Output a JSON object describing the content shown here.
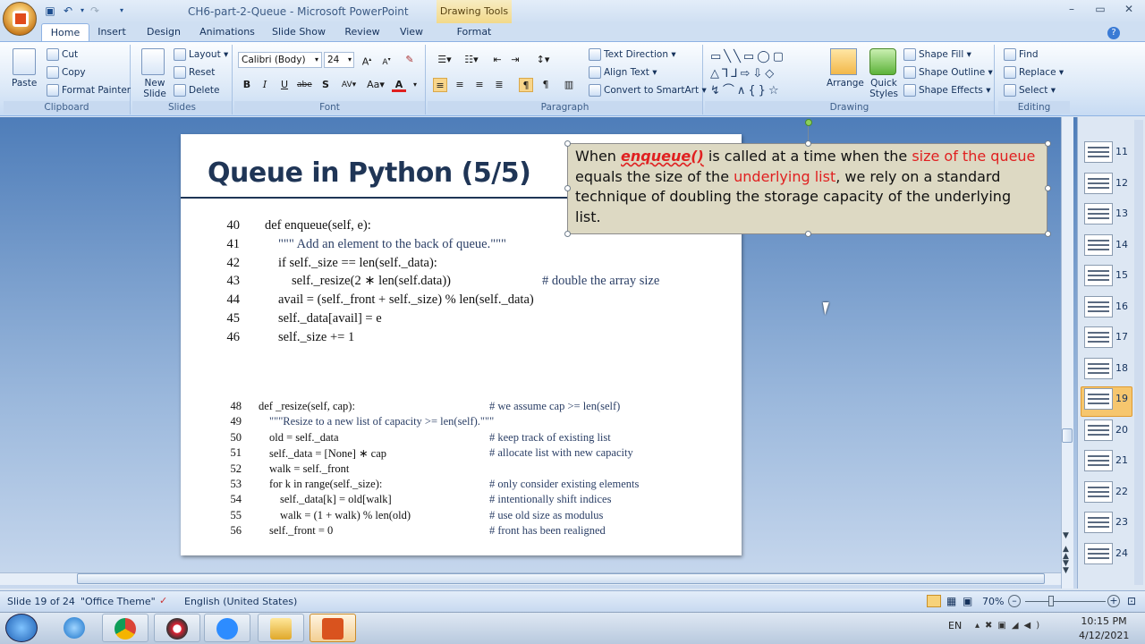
{
  "window": {
    "title": "CH6-part-2-Queue - Microsoft PowerPoint",
    "contextual_tab": "Drawing Tools"
  },
  "tabs": [
    "Home",
    "Insert",
    "Design",
    "Animations",
    "Slide Show",
    "Review",
    "View",
    "Format"
  ],
  "ribbon": {
    "clipboard": {
      "label": "Clipboard",
      "paste": "Paste",
      "cut": "Cut",
      "copy": "Copy",
      "format_painter": "Format Painter"
    },
    "slides": {
      "label": "Slides",
      "new_slide": "New Slide",
      "layout": "Layout",
      "reset": "Reset",
      "delete": "Delete"
    },
    "font": {
      "label": "Font",
      "family": "Calibri (Body)",
      "size": "24"
    },
    "paragraph": {
      "label": "Paragraph",
      "text_direction": "Text Direction",
      "align_text": "Align Text",
      "convert_smartart": "Convert to SmartArt"
    },
    "drawing": {
      "label": "Drawing",
      "arrange": "Arrange",
      "quick_styles": "Quick Styles",
      "shape_fill": "Shape Fill",
      "shape_outline": "Shape Outline",
      "shape_effects": "Shape Effects"
    },
    "editing": {
      "label": "Editing",
      "find": "Find",
      "replace": "Replace",
      "select": "Select"
    }
  },
  "slide": {
    "title": "Queue in Python (5/5)",
    "code_block_1": [
      {
        "n": "40",
        "text": "def enqueue(self, e):",
        "indent": 0,
        "comment": ""
      },
      {
        "n": "41",
        "text": "\"\"\" Add an element to the back of queue.\"\"\"",
        "indent": 1,
        "comment": ""
      },
      {
        "n": "42",
        "text": "if self._size == len(self._data):",
        "indent": 1,
        "comment": ""
      },
      {
        "n": "43",
        "text": "self._resize(2 ∗ len(self.data))",
        "indent": 2,
        "comment": "# double the array size"
      },
      {
        "n": "44",
        "text": "avail = (self._front + self._size) % len(self._data)",
        "indent": 1,
        "comment": ""
      },
      {
        "n": "45",
        "text": "self._data[avail] = e",
        "indent": 1,
        "comment": ""
      },
      {
        "n": "46",
        "text": "self._size += 1",
        "indent": 1,
        "comment": ""
      }
    ],
    "code_block_2": [
      {
        "n": "48",
        "text": "def _resize(self, cap):",
        "indent": 0,
        "comment": "# we assume cap >= len(self)"
      },
      {
        "n": "49",
        "text": "\"\"\"Resize to a new list of capacity >= len(self).\"\"\"",
        "indent": 1,
        "comment": ""
      },
      {
        "n": "50",
        "text": "old = self._data",
        "indent": 1,
        "comment": "# keep track of existing list"
      },
      {
        "n": "51",
        "text": "self._data = [None] ∗ cap",
        "indent": 1,
        "comment": "# allocate list with new capacity"
      },
      {
        "n": "52",
        "text": "walk = self._front",
        "indent": 1,
        "comment": ""
      },
      {
        "n": "53",
        "text": "for k in range(self._size):",
        "indent": 1,
        "comment": "# only consider existing elements"
      },
      {
        "n": "54",
        "text": "self._data[k] = old[walk]",
        "indent": 2,
        "comment": "# intentionally shift indices"
      },
      {
        "n": "55",
        "text": "walk = (1 + walk) % len(old)",
        "indent": 2,
        "comment": "# use old size as modulus"
      },
      {
        "n": "56",
        "text": "self._front = 0",
        "indent": 1,
        "comment": "# front has been realigned"
      }
    ],
    "note": {
      "p1": "When ",
      "enqueue": "enqueue()",
      "p2": " is called at a time when the ",
      "size_of_queue": "size of the queue",
      "p3": " equals the size of the ",
      "underlying_list": "underlying list",
      "p4": ", we rely on a standard technique of doubling the storage capacity of the underlying list."
    }
  },
  "thumbnails": [
    "11",
    "12",
    "13",
    "14",
    "15",
    "16",
    "17",
    "18",
    "19",
    "20",
    "21",
    "22",
    "23",
    "24"
  ],
  "selected_thumbnail": "19",
  "status": {
    "slide": "Slide 19 of 24",
    "theme": "\"Office Theme\"",
    "language": "English (United States)",
    "zoom": "70%"
  },
  "taskbar": {
    "lang": "EN",
    "time": "10:15 PM",
    "date": "4/12/2021"
  },
  "colors": {
    "accent_red": "#e02020",
    "note_bg": "#ddd9c3",
    "title": "#1f3556",
    "selected_thumb": "#f6c66e"
  }
}
